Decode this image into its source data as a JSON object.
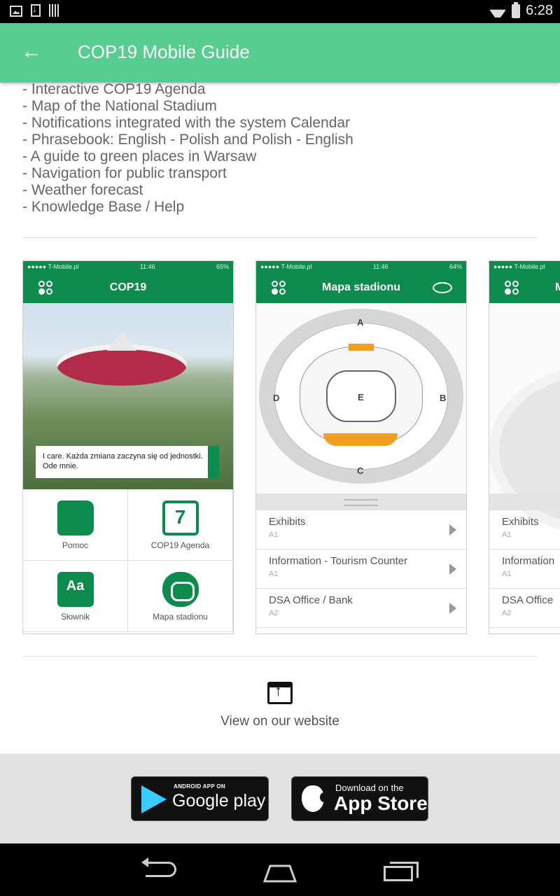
{
  "status_bar": {
    "time": "6:28"
  },
  "app_bar": {
    "title": "COP19 Mobile Guide"
  },
  "features": [
    "- Interactive COP19 Agenda",
    "- Map of the National Stadium",
    "- Notifications integrated with the system Calendar",
    "- Phrasebook: English - Polish and Polish - English",
    "- A guide to green places in Warsaw",
    "- Navigation for public transport",
    "- Weather forecast",
    "- Knowledge Base / Help"
  ],
  "screenshots": {
    "shot1": {
      "status_left": "●●●●● T-Mobile.pl",
      "status_time": "11:46",
      "status_right": "65%",
      "title": "COP19",
      "caption": "I care. Każda zmiana zaczyna się od jednostki. Ode mnie.",
      "tiles": [
        {
          "label": "Pomoc"
        },
        {
          "label": "COP19 Agenda",
          "number": "7"
        },
        {
          "label": "Słownik",
          "glyph": "Aa"
        },
        {
          "label": "Mapa stadionu"
        }
      ]
    },
    "shot2": {
      "status_left": "●●●●● T-Mobile.pl",
      "status_time": "11:46",
      "status_right": "64%",
      "title": "Mapa stadionu",
      "map_labels": {
        "a": "A",
        "b": "B",
        "c": "C",
        "d": "D",
        "e": "E"
      },
      "rows": [
        {
          "title": "Exhibits",
          "sub": "A1"
        },
        {
          "title": "Information - Tourism Counter",
          "sub": "A1"
        },
        {
          "title": "DSA Office / Bank",
          "sub": "A2"
        }
      ]
    },
    "shot3": {
      "status_left": "●●●●● T-Mobile.pl",
      "title": "M",
      "rows": [
        {
          "title": "Exhibits",
          "sub": "A1"
        },
        {
          "title": "Information",
          "sub": "A1"
        },
        {
          "title": "DSA Office",
          "sub": "A2"
        }
      ]
    }
  },
  "website": {
    "label": "View on our website"
  },
  "stores": {
    "google": {
      "small": "ANDROID APP ON",
      "big": "Google play"
    },
    "apple": {
      "small": "Download on the",
      "big": "App Store"
    }
  },
  "colors": {
    "accent": "#57cd8f",
    "app_green": "#0d8b4c"
  }
}
